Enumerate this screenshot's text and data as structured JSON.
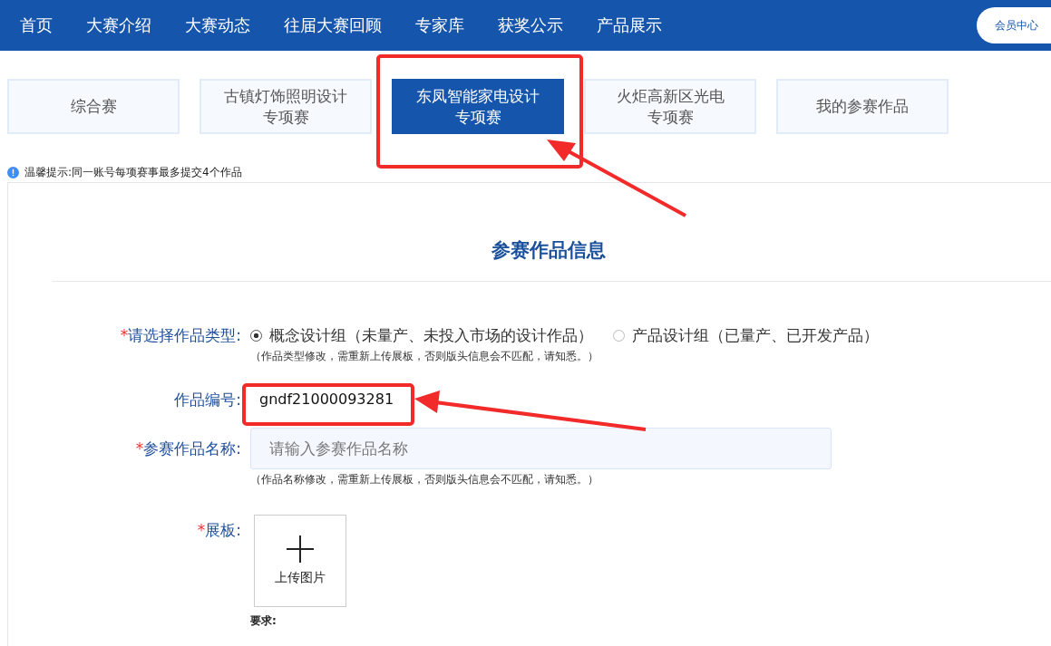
{
  "nav": {
    "items": [
      "首页",
      "大赛介绍",
      "大赛动态",
      "往届大赛回顾",
      "专家库",
      "获奖公示",
      "产品展示"
    ],
    "member_button": "会员中心"
  },
  "tabs": [
    {
      "lines": [
        "综合赛"
      ],
      "selected": false
    },
    {
      "lines": [
        "古镇灯饰照明设计",
        "专项赛"
      ],
      "selected": false
    },
    {
      "lines": [
        "东凤智能家电设计",
        "专项赛"
      ],
      "selected": true
    },
    {
      "lines": [
        "火炬高新区光电",
        "专项赛"
      ],
      "selected": false
    },
    {
      "lines": [
        "我的参赛作品"
      ],
      "selected": false
    }
  ],
  "tip": "温馨提示:同一账号每项赛事最多提交4个作品",
  "form": {
    "title": "参赛作品信息",
    "type_field": {
      "mark": "*",
      "label": "请选择作品类型:",
      "options": [
        {
          "label": "概念设计组（未量产、未投入市场的设计作品）",
          "selected": true
        },
        {
          "label": "产品设计组（已量产、已开发产品）",
          "selected": false
        }
      ],
      "note": "（作品类型修改，需重新上传展板，否则版头信息会不匹配，请知悉。）"
    },
    "code_field": {
      "label": "作品编号:",
      "value": "gndf21000093281"
    },
    "name_field": {
      "mark": "*",
      "label": "参赛作品名称:",
      "placeholder": "请输入参赛作品名称",
      "note": "（作品名称修改，需重新上传展板，否则版头信息会不匹配，请知悉。）"
    },
    "board_field": {
      "mark": "*",
      "label": "展板:",
      "upload_label": "上传图片",
      "requirements_title": "要求:"
    }
  }
}
